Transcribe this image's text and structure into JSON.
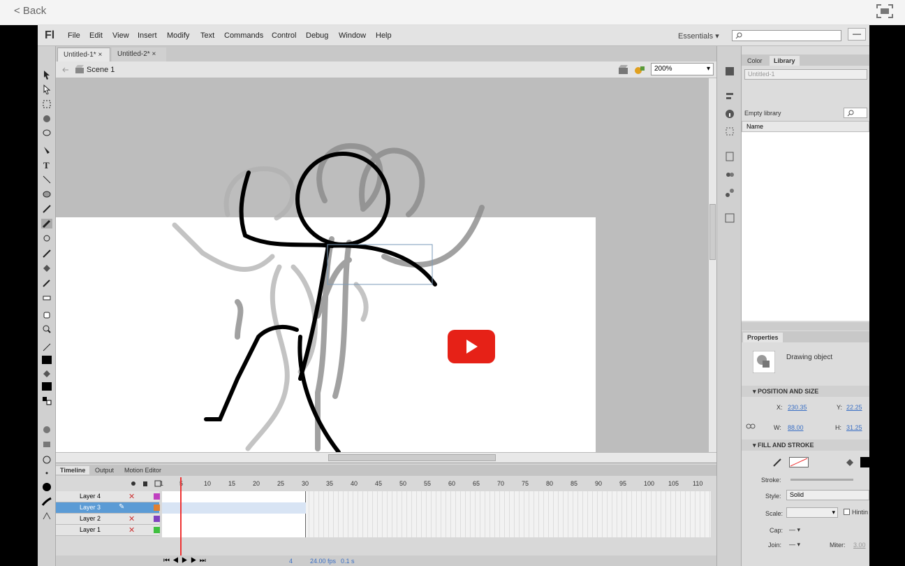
{
  "top": {
    "back_label": "< Back"
  },
  "menubar": {
    "logo": "Fl",
    "items": [
      "File",
      "Edit",
      "View",
      "Insert",
      "Modify",
      "Text",
      "Commands",
      "Control",
      "Debug",
      "Window",
      "Help"
    ],
    "workspace": "Essentials",
    "minimize": "—"
  },
  "doc_tabs": [
    "Untitled-1*",
    "Untitled-2*"
  ],
  "scene": {
    "name": "Scene 1",
    "zoom": "200%"
  },
  "panel_tabs": {
    "color": "Color",
    "library": "Library"
  },
  "library": {
    "document": "Untitled-1",
    "status": "Empty library",
    "name_col": "Name"
  },
  "properties": {
    "tab": "Properties",
    "object_type": "Drawing object",
    "position_section": "POSITION AND SIZE",
    "x_label": "X:",
    "x_value": "230.35",
    "y_label": "Y:",
    "y_value": "22.25",
    "w_label": "W:",
    "w_value": "88.00",
    "h_label": "H:",
    "h_value": "31.25",
    "fill_section": "FILL AND STROKE",
    "stroke_label": "Stroke:",
    "style_label": "Style:",
    "style_value": "Solid",
    "scale_label": "Scale:",
    "hinting_label": "Hintin",
    "cap_label": "Cap:",
    "join_label": "Join:",
    "miter_label": "Miter:",
    "miter_value": "3.00"
  },
  "timeline": {
    "tabs": [
      "Timeline",
      "Output",
      "Motion Editor"
    ],
    "layers": [
      "Layer 4",
      "Layer 3",
      "Layer 2",
      "Layer 1"
    ],
    "frame_numbers": [
      "1",
      "5",
      "10",
      "15",
      "20",
      "25",
      "30",
      "35",
      "40",
      "45",
      "50",
      "55",
      "60",
      "65",
      "70",
      "75",
      "80",
      "85",
      "90",
      "95",
      "100",
      "105",
      "110"
    ],
    "fps": "24.00 fps",
    "time": "0.1 s",
    "current_frame": "4"
  },
  "colors": {
    "youtube_red": "#e62117",
    "selected_layer": "#5b9bd5",
    "playhead": "#ee3333"
  }
}
